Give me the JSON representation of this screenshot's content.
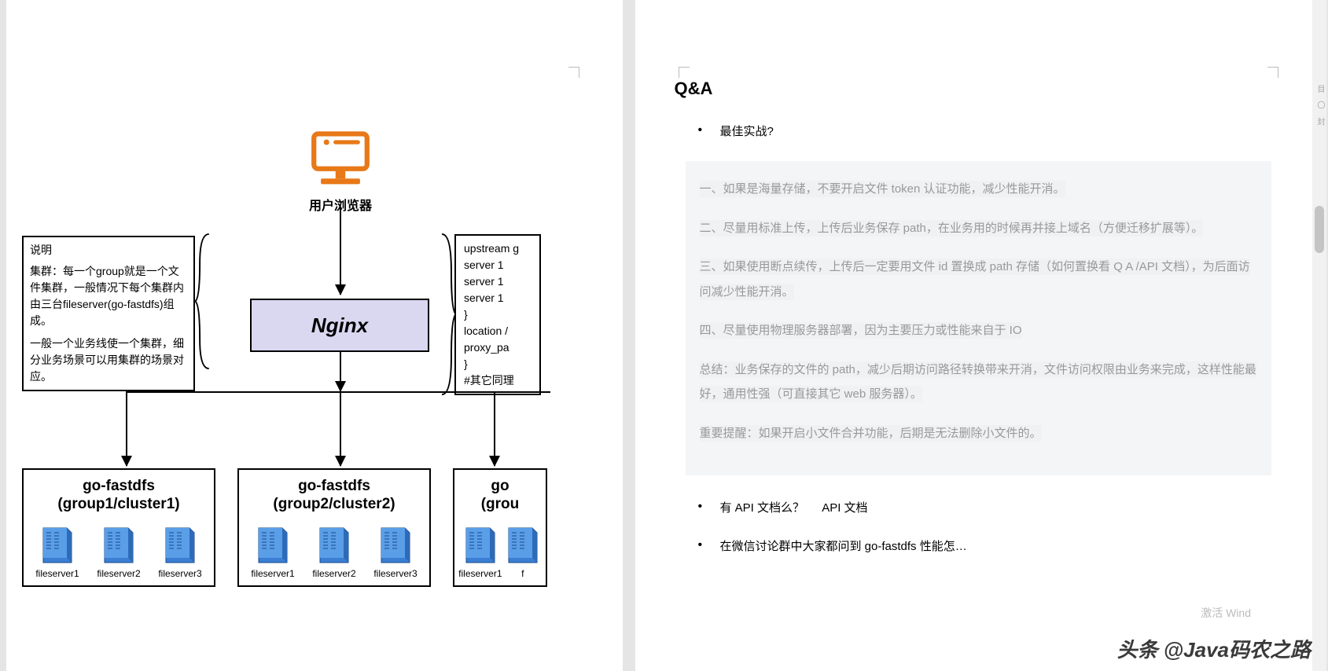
{
  "left": {
    "monitor_label": "用户浏览器",
    "note_left_title": "说明",
    "note_left_p1": "集群：每一个group就是一个文件集群，一般情况下每个集群内由三台fileserver(go-fastdfs)组成。",
    "note_left_p2": "一般一个业务线使一个集群，细分业务场景可以用集群的场景对应。",
    "note_right_lines": [
      "upstream g",
      "server 1",
      "server 1",
      "server 1",
      "}",
      "location /",
      "proxy_pa",
      "}",
      "#其它同理"
    ],
    "nginx_label": "Nginx",
    "clusters": [
      {
        "title_l1": "go-fastdfs",
        "title_l2": "(group1/cluster1)",
        "servers": [
          "fileserver1",
          "fileserver2",
          "fileserver3"
        ]
      },
      {
        "title_l1": "go-fastdfs",
        "title_l2": "(group2/cluster2)",
        "servers": [
          "fileserver1",
          "fileserver2",
          "fileserver3"
        ]
      },
      {
        "title_l1": "go",
        "title_l2": "(grou",
        "servers": [
          "fileserver1",
          "f"
        ]
      }
    ]
  },
  "right": {
    "qa_title": "Q&A",
    "q1": "最佳实战?",
    "answers": [
      "一、如果是海量存储，不要开启文件 token 认证功能，减少性能开消。",
      "二、尽量用标准上传，上传后业务保存 path，在业务用的时候再并接上域名（方便迁移扩展等）。",
      "三、如果使用断点续传，上传后一定要用文件 id 置换成 path 存储（如何置换看 Q A /API 文档），为后面访问减少性能开消。",
      "四、尽量使用物理服务器部署，因为主要压力或性能来自于 IO",
      "总结：业务保存的文件的 path，减少后期访问路径转换带来开消，文件访问权限由业务来完成，这样性能最好，通用性强（可直接其它 web 服务器）。",
      "重要提醒：如果开启小文件合并功能，后期是无法删除小文件的。"
    ],
    "q2_a": "有 API 文档么？",
    "q2_b": "API 文档",
    "q3": "在微信讨论群中大家都问到 go-fastdfs 性能怎…",
    "watermark": "激活 Wind",
    "brand": "头条 @Java码农之路"
  },
  "side_tools": "目 〇 封"
}
